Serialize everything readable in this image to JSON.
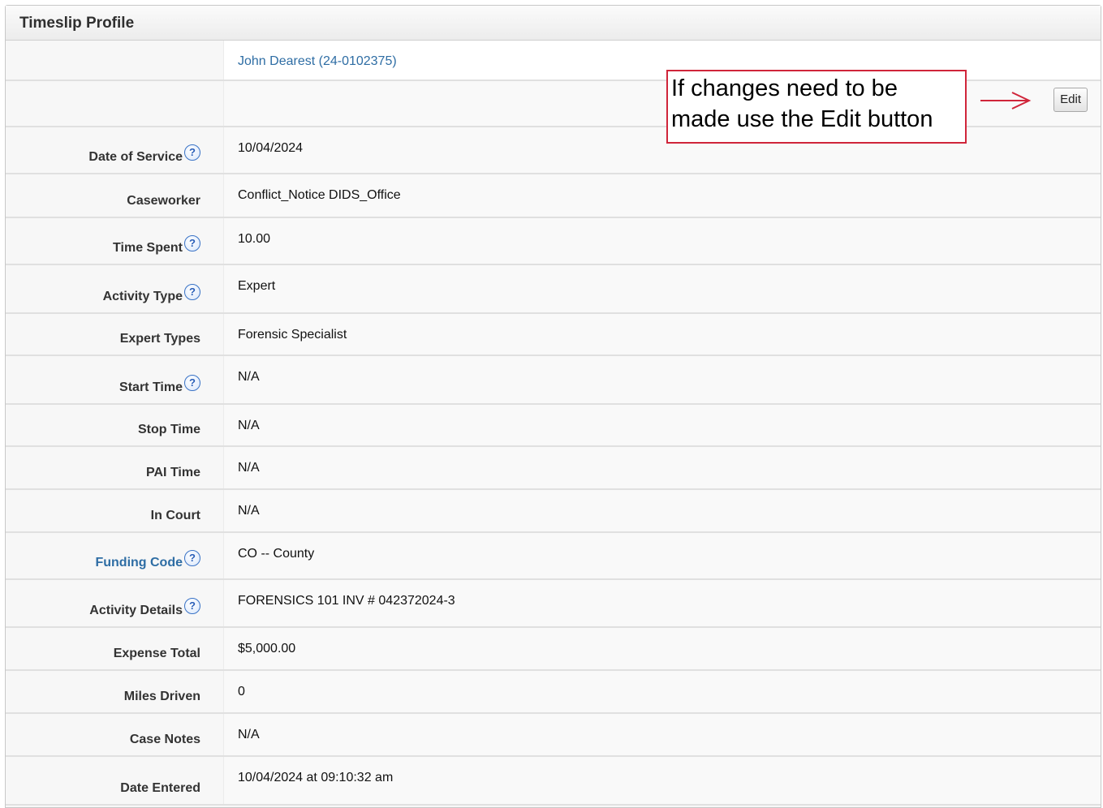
{
  "panel": {
    "title": "Timeslip Profile"
  },
  "client_link": "John Dearest (24-0102375)",
  "edit_label": "Edit",
  "callout": {
    "line1": "If changes need to be",
    "line2": "made use the Edit button"
  },
  "fields": [
    {
      "label": "Date of Service",
      "value": "10/04/2024",
      "help": true,
      "link": false
    },
    {
      "label": "Caseworker",
      "value": "Conflict_Notice DIDS_Office",
      "help": false,
      "link": false
    },
    {
      "label": "Time Spent",
      "value": "10.00",
      "help": true,
      "link": false
    },
    {
      "label": "Activity Type",
      "value": "Expert",
      "help": true,
      "link": false
    },
    {
      "label": "Expert Types",
      "value": "Forensic Specialist",
      "help": false,
      "link": false
    },
    {
      "label": "Start Time",
      "value": "N/A",
      "help": true,
      "link": false
    },
    {
      "label": "Stop Time",
      "value": "N/A",
      "help": false,
      "link": false
    },
    {
      "label": "PAI Time",
      "value": "N/A",
      "help": false,
      "link": false
    },
    {
      "label": "In Court",
      "value": "N/A",
      "help": false,
      "link": false
    },
    {
      "label": "Funding Code",
      "value": "CO -- County",
      "help": true,
      "link": true
    },
    {
      "label": "Activity Details",
      "value": "FORENSICS 101 INV # 042372024-3",
      "help": true,
      "link": false
    },
    {
      "label": "Expense Total",
      "value": "$5,000.00",
      "help": false,
      "link": false
    },
    {
      "label": "Miles Driven",
      "value": "0",
      "help": false,
      "link": false
    },
    {
      "label": "Case Notes",
      "value": "N/A",
      "help": false,
      "link": false
    },
    {
      "label": "Date Entered",
      "value": "10/04/2024 at 09:10:32 am",
      "help": false,
      "link": false
    }
  ],
  "icons": {
    "help": "question-mark-circle",
    "arrow": "right-arrow"
  },
  "colors": {
    "link": "#2e6da4",
    "callout_border": "#d0253a",
    "help_icon": "#3a73c6"
  }
}
